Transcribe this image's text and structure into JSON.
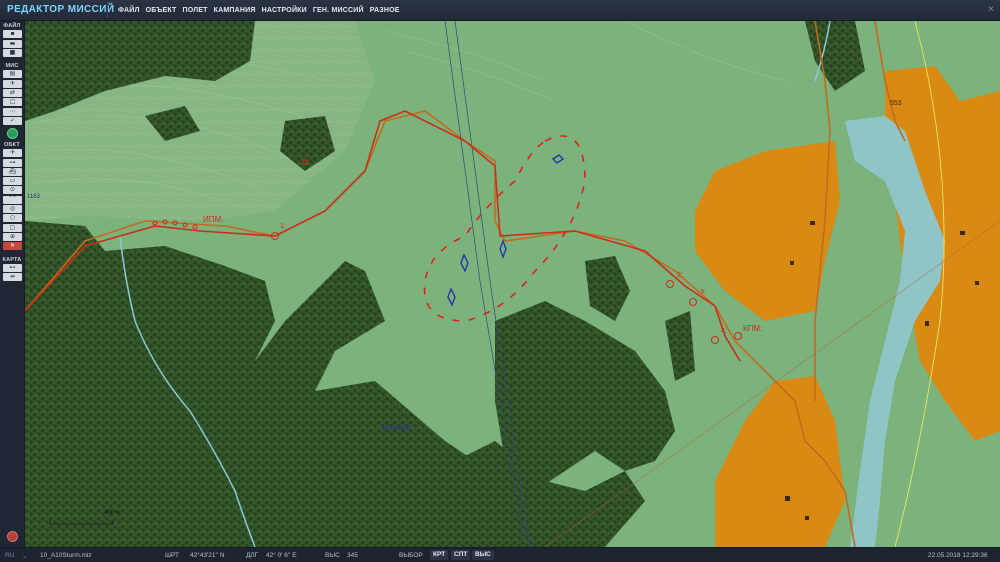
{
  "app": {
    "title": "РЕДАКТОР МИССИЙ",
    "close_glyph": "×"
  },
  "menu": [
    {
      "label": "ФАЙЛ"
    },
    {
      "label": "ОБЪЕКТ"
    },
    {
      "label": "ПОЛЕТ"
    },
    {
      "label": "КАМПАНИЯ"
    },
    {
      "label": "НАСТРОЙКИ"
    },
    {
      "label": "ГЕН. МИССИЙ"
    },
    {
      "label": "РАЗНОЕ"
    }
  ],
  "toolbar": {
    "sections": {
      "file": "ФАЙЛ",
      "mission": "МИС",
      "object": "ОБКТ",
      "map": "КАРТА"
    },
    "file_buttons": [
      {
        "icon": "new-file-icon",
        "glyph": "▪"
      },
      {
        "icon": "open-folder-icon",
        "glyph": "▬"
      },
      {
        "icon": "save-icon",
        "glyph": "■"
      }
    ],
    "mission_buttons": [
      {
        "icon": "briefing-icon",
        "glyph": "▤"
      },
      {
        "icon": "aircraft-icon",
        "glyph": "✈"
      },
      {
        "icon": "trigger-icon",
        "glyph": "⇄"
      },
      {
        "icon": "page-icon",
        "glyph": "□"
      },
      {
        "icon": "script-icon",
        "glyph": "⋯"
      },
      {
        "icon": "check-icon",
        "glyph": "✓"
      }
    ],
    "object_buttons": [
      {
        "icon": "plane-icon",
        "glyph": "✈"
      },
      {
        "icon": "helicopter-icon",
        "glyph": "⊶"
      },
      {
        "icon": "ship-icon",
        "glyph": "⛴"
      },
      {
        "icon": "vehicle-icon",
        "glyph": "▭"
      },
      {
        "icon": "static-icon",
        "glyph": "⊙"
      },
      {
        "icon": "zone-icon",
        "glyph": "⌒"
      },
      {
        "icon": "target-icon",
        "glyph": "◎"
      },
      {
        "icon": "circle-icon",
        "glyph": "○"
      },
      {
        "icon": "square-icon",
        "glyph": "▢"
      },
      {
        "icon": "group-icon",
        "glyph": "⊕"
      },
      {
        "icon": "delete-icon",
        "glyph": "✕"
      }
    ],
    "map_buttons": [
      {
        "icon": "ruler-icon",
        "glyph": "⊷"
      },
      {
        "icon": "measure-icon",
        "glyph": "⇹"
      }
    ]
  },
  "map": {
    "labels": {
      "ipm": "ИПМ:",
      "kpm": "КПМ:",
      "wp1": "1:",
      "wp2": "2:",
      "wp3": "3:",
      "wp4": "4:",
      "town": "Мужава",
      "scale": "400 м",
      "elevation_left": "1163",
      "elevation_right": "553"
    },
    "colors": {
      "terrain": "#7cb27b",
      "forest": "#2f4d22",
      "town": "#d88a12",
      "river": "#8fc5c6",
      "route": "#c8301c",
      "zone": "#e02020",
      "unit": "#2636a8"
    }
  },
  "status": {
    "lang": "RU",
    "file": "10_A10Sturm.miz",
    "lat_label": "ШРТ",
    "lat_value": "42°43'21'' N",
    "lon_label": "ДЛГ",
    "lon_value": "42° 0' 6'' E",
    "alt_label": "ВЫС",
    "alt_value": "345",
    "select_label": "ВЫБОР",
    "btn_krt": "КРТ",
    "btn_spt": "СПТ",
    "btn_vys": "ВЫС",
    "datetime": "22.05.2018 12:29:36"
  }
}
